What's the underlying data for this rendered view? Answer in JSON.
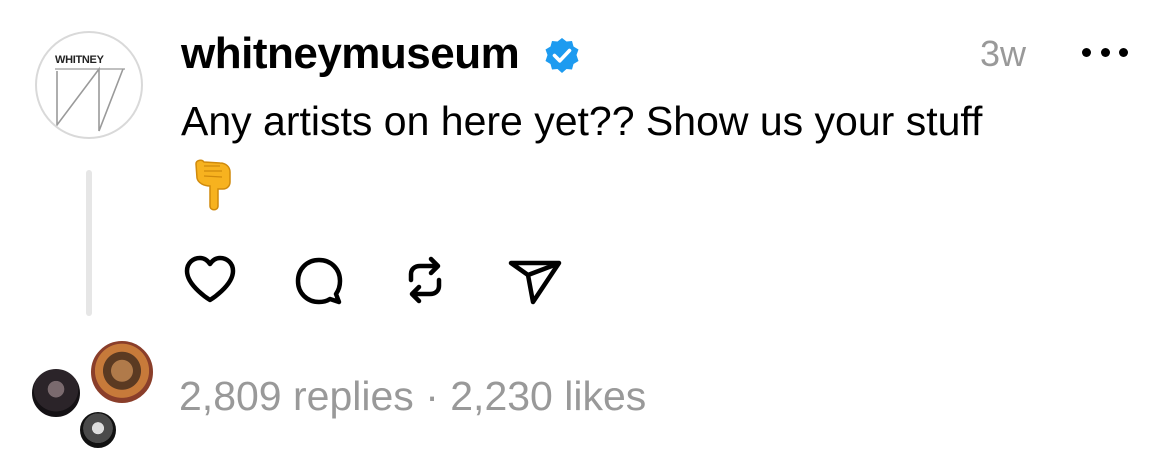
{
  "post": {
    "username": "whitneymuseum",
    "logo_text": "WHITNEY",
    "time": "3w",
    "text": "Any artists on here yet?? Show us your stuff",
    "emoji": "👇",
    "replies": "2,809 replies",
    "separator": "·",
    "likes": "2,230 likes"
  },
  "icons": {
    "verified": "verified-badge-icon",
    "like": "heart-icon",
    "reply": "comment-bubble-icon",
    "repost": "repost-icon",
    "share": "send-icon",
    "more": "more-horizontal-icon"
  },
  "colors": {
    "verified": "#1d9bf0",
    "muted": "#999999",
    "thread_line": "#e6e6e6"
  }
}
